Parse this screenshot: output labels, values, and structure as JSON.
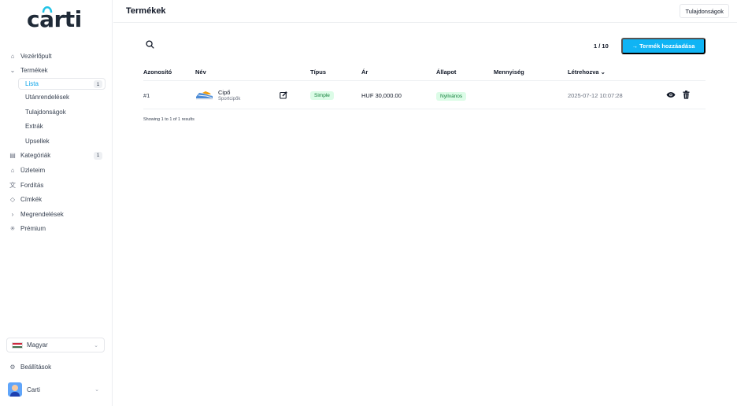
{
  "brand": {
    "logo_text": "carti"
  },
  "header": {
    "title": "Termékek",
    "button_label": "Tulajdonságok"
  },
  "sidebar": {
    "items": [
      {
        "label": "Vezérlőpult",
        "icon": "home-icon"
      },
      {
        "label": "Termékek",
        "icon": "chevron-down-icon"
      },
      {
        "label": "Lista",
        "badge": "1",
        "active": true
      },
      {
        "label": "Utánrendelések"
      },
      {
        "label": "Tulajdonságok"
      },
      {
        "label": "Extrák"
      },
      {
        "label": "Upsellek"
      },
      {
        "label": "Kategóriák",
        "icon": "category-icon",
        "badge": "1"
      },
      {
        "label": "Üzleteim",
        "icon": "store-icon"
      },
      {
        "label": "Fordítás",
        "icon": "translate-icon"
      },
      {
        "label": "Címkék",
        "icon": "tag-icon"
      },
      {
        "label": "Megrendelések",
        "icon": "chevron-right-icon"
      },
      {
        "label": "Prémium",
        "icon": "sparkle-icon"
      }
    ],
    "language": "Magyar",
    "settings": "Beállítások",
    "user": "Carti"
  },
  "toolbar": {
    "pager": "1 / 10",
    "add_label": "→  Termék hozzáadása"
  },
  "table": {
    "headers": [
      "Azonosító",
      "Név",
      "Típus",
      "Ár",
      "Állapot",
      "Mennyiség",
      "Létrehozva ⌄"
    ],
    "rows": [
      {
        "id": "#1",
        "name": "Cipő",
        "category": "Sportcipők",
        "type": "Simple",
        "price": "HUF 30,000.00",
        "status": "Nyilvános",
        "quantity": "",
        "created": "2025-07-12 10:07:28"
      }
    ],
    "results": "Showing 1 to 1 of 1 results"
  },
  "colors": {
    "accent": "#10b4f4",
    "active_text": "#0ea5e9",
    "pill_bg": "#dcfce7",
    "pill_text": "#15803d"
  }
}
